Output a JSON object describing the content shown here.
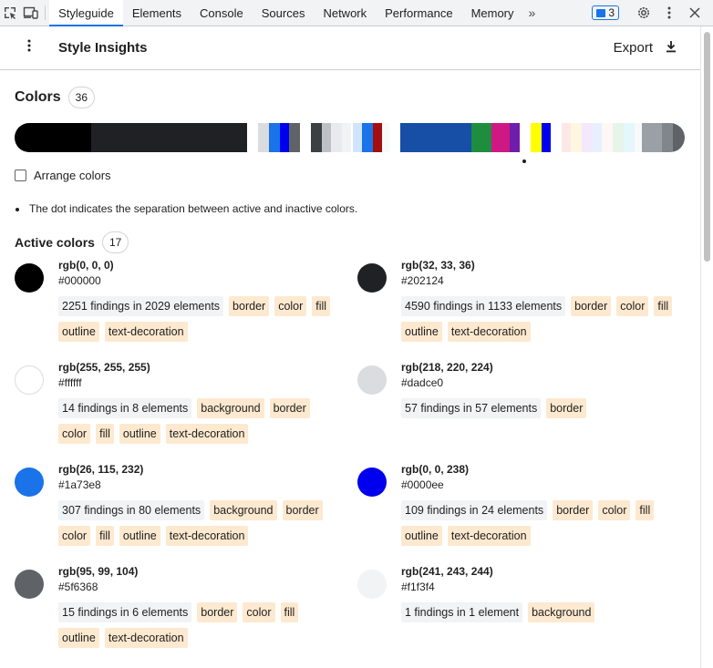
{
  "toolbar": {
    "tabs": [
      "Styleguide",
      "Elements",
      "Console",
      "Sources",
      "Network",
      "Performance",
      "Memory"
    ],
    "more_tabs": "»",
    "issues_count": "3"
  },
  "panel": {
    "title": "Style Insights",
    "export_label": "Export"
  },
  "colors_section": {
    "title": "Colors",
    "count": "36",
    "strip": [
      {
        "color": "#000000",
        "w": 84
      },
      {
        "color": "#202124",
        "w": 172
      },
      {
        "color": "#ffffff",
        "w": 12
      },
      {
        "color": "#dadce0",
        "w": 12
      },
      {
        "color": "#1a73e8",
        "w": 12
      },
      {
        "color": "#0000ee",
        "w": 10
      },
      {
        "color": "#5f6368",
        "w": 12
      },
      {
        "color": "#ffffff",
        "w": 12
      },
      {
        "color": "#3c4043",
        "w": 12
      },
      {
        "color": "#bdc1c6",
        "w": 10
      },
      {
        "color": "#e8eaed",
        "w": 12
      },
      {
        "color": "#f1f3f4",
        "w": 10
      },
      {
        "color": "#ffffff",
        "w": 2
      },
      {
        "color": "#d2e3fc",
        "w": 10
      },
      {
        "color": "#1a73e8",
        "w": 12
      },
      {
        "color": "#a50e0e",
        "w": 10
      },
      {
        "color": "#f8f9fa",
        "w": 8
      },
      {
        "color": "#ffffff",
        "w": 12
      },
      {
        "color": "#174ea6",
        "w": 78
      },
      {
        "color": "#1e8e3e",
        "w": 22
      },
      {
        "color": "#d01884",
        "w": 20
      },
      {
        "color": "#6f1dab",
        "w": 12
      },
      {
        "color": "#ffffff",
        "w": 12
      },
      {
        "color": "#ffff00",
        "w": 12
      },
      {
        "color": "#0000ee",
        "w": 10
      },
      {
        "color": "#ffffff",
        "w": 12
      },
      {
        "color": "#fce8e6",
        "w": 10
      },
      {
        "color": "#fef7e0",
        "w": 12
      },
      {
        "color": "#f3e8fd",
        "w": 12
      },
      {
        "color": "#e8f0fe",
        "w": 10
      },
      {
        "color": "#fef7f6",
        "w": 12
      },
      {
        "color": "#e6f4ea",
        "w": 12
      },
      {
        "color": "#e4f7fb",
        "w": 12
      },
      {
        "color": "#f8f9fa",
        "w": 8
      },
      {
        "color": "#9aa0a6",
        "w": 22
      },
      {
        "color": "#80868b",
        "w": 12
      },
      {
        "color": "#5f6368",
        "w": 13
      }
    ],
    "arrange_label": "Arrange colors",
    "note": "The dot indicates the separation between active and inactive colors."
  },
  "active_section": {
    "title": "Active colors",
    "count": "17"
  },
  "cards": [
    {
      "rgb": "rgb(0, 0, 0)",
      "hex": "#000000",
      "swatch": "#000000",
      "findings": "2251 findings in 2029 elements",
      "props": [
        "border",
        "color",
        "fill",
        "outline",
        "text-decoration"
      ]
    },
    {
      "rgb": "rgb(32, 33, 36)",
      "hex": "#202124",
      "swatch": "#202124",
      "findings": "4590 findings in 1133 elements",
      "props": [
        "border",
        "color",
        "fill",
        "outline",
        "text-decoration"
      ]
    },
    {
      "rgb": "rgb(255, 255, 255)",
      "hex": "#ffffff",
      "swatch": "#ffffff",
      "findings": "14 findings in 8 elements",
      "props": [
        "background",
        "border",
        "color",
        "fill",
        "outline",
        "text-decoration"
      ]
    },
    {
      "rgb": "rgb(218, 220, 224)",
      "hex": "#dadce0",
      "swatch": "#dadce0",
      "findings": "57 findings in 57 elements",
      "props": [
        "border"
      ]
    },
    {
      "rgb": "rgb(26, 115, 232)",
      "hex": "#1a73e8",
      "swatch": "#1a73e8",
      "findings": "307 findings in 80 elements",
      "props": [
        "background",
        "border",
        "color",
        "fill",
        "outline",
        "text-decoration"
      ]
    },
    {
      "rgb": "rgb(0, 0, 238)",
      "hex": "#0000ee",
      "swatch": "#0000ee",
      "findings": "109 findings in 24 elements",
      "props": [
        "border",
        "color",
        "fill",
        "outline",
        "text-decoration"
      ]
    },
    {
      "rgb": "rgb(95, 99, 104)",
      "hex": "#5f6368",
      "swatch": "#5f6368",
      "findings": "15 findings in 6 elements",
      "props": [
        "border",
        "color",
        "fill",
        "outline",
        "text-decoration"
      ]
    },
    {
      "rgb": "rgb(241, 243, 244)",
      "hex": "#f1f3f4",
      "swatch": "#f1f3f4",
      "findings": "1 findings in 1 element",
      "props": [
        "background"
      ]
    }
  ]
}
